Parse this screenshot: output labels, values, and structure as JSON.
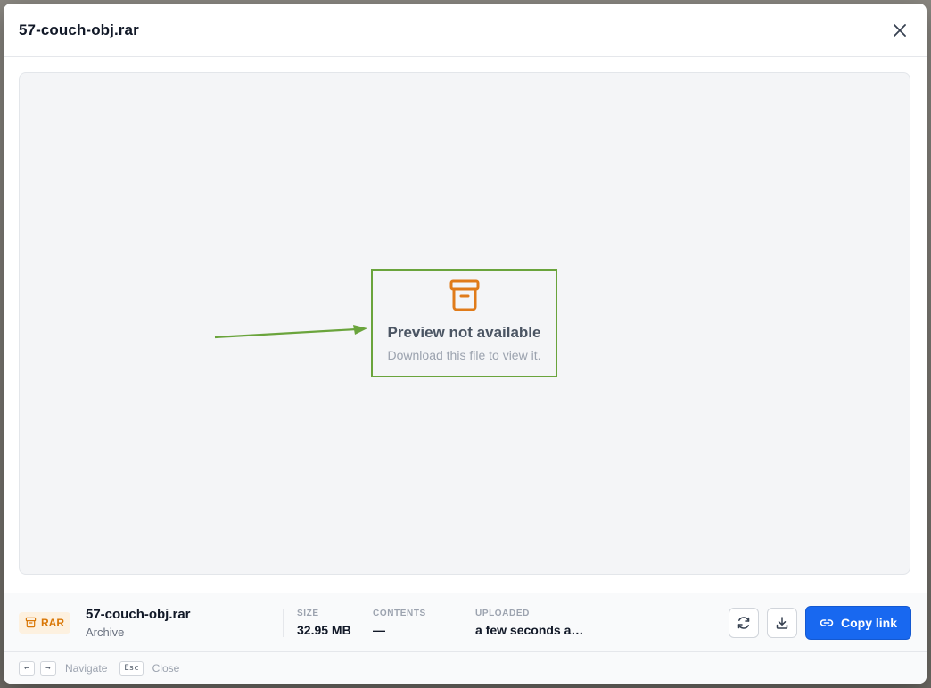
{
  "modal": {
    "title": "57-couch-obj.rar"
  },
  "preview": {
    "icon": "archive-icon",
    "title": "Preview not available",
    "subtitle": "Download this file to view it.",
    "icon_color": "#e07b1a",
    "highlight_color": "#6aa43c"
  },
  "footer": {
    "badge": "RAR",
    "file_name": "57-couch-obj.rar",
    "file_type": "Archive",
    "meta": {
      "size_label": "SIZE",
      "size_value": "32.95 MB",
      "contents_label": "CONTENTS",
      "contents_value": "—",
      "uploaded_label": "UPLOADED",
      "uploaded_value": "a few seconds a…"
    },
    "copy_link_label": "Copy link"
  },
  "hints": {
    "left_key": "←",
    "right_key": "→",
    "navigate_label": "Navigate",
    "esc_key": "Esc",
    "close_label": "Close"
  },
  "colors": {
    "primary": "#1868f0",
    "badge_bg": "#fdf1e0",
    "badge_text": "#d97706"
  }
}
